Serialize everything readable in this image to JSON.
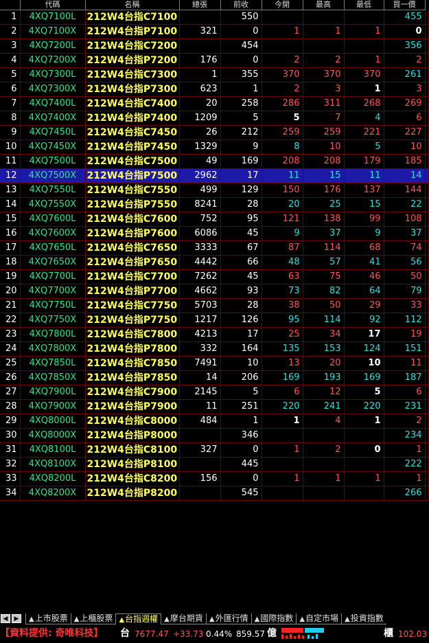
{
  "columns": [
    "代碼",
    "名稱",
    "總張",
    "前收",
    "今開",
    "最高",
    "最低",
    "買一價"
  ],
  "selected_row": 12,
  "rows": [
    {
      "no": "1",
      "code": "4XQ7100L",
      "name": "212W4台指C7100",
      "vol": "",
      "prev": "550",
      "open": "",
      "high": "",
      "low": "",
      "bid": "455"
    },
    {
      "no": "2",
      "code": "4XQ7100X",
      "name": "212W4台指P7100",
      "vol": "321",
      "prev": "0",
      "open": "1",
      "high": "1",
      "low": "1",
      "bid": "0"
    },
    {
      "no": "3",
      "code": "4XQ7200L",
      "name": "212W4台指C7200",
      "vol": "",
      "prev": "454",
      "open": "",
      "high": "",
      "low": "",
      "bid": "356"
    },
    {
      "no": "4",
      "code": "4XQ7200X",
      "name": "212W4台指P7200",
      "vol": "176",
      "prev": "0",
      "open": "2",
      "high": "2",
      "low": "1",
      "bid": "2"
    },
    {
      "no": "5",
      "code": "4XQ7300L",
      "name": "212W4台指C7300",
      "vol": "1",
      "prev": "355",
      "open": "370",
      "high": "370",
      "low": "370",
      "bid": "261"
    },
    {
      "no": "6",
      "code": "4XQ7300X",
      "name": "212W4台指P7300",
      "vol": "623",
      "prev": "1",
      "open": "2",
      "high": "3",
      "low": "1",
      "bid": "3"
    },
    {
      "no": "7",
      "code": "4XQ7400L",
      "name": "212W4台指C7400",
      "vol": "20",
      "prev": "258",
      "open": "286",
      "high": "311",
      "low": "268",
      "bid": "269"
    },
    {
      "no": "8",
      "code": "4XQ7400X",
      "name": "212W4台指P7400",
      "vol": "1209",
      "prev": "5",
      "open": "5",
      "high": "7",
      "low": "4",
      "bid": "6"
    },
    {
      "no": "9",
      "code": "4XQ7450L",
      "name": "212W4台指C7450",
      "vol": "26",
      "prev": "212",
      "open": "259",
      "high": "259",
      "low": "221",
      "bid": "227"
    },
    {
      "no": "10",
      "code": "4XQ7450X",
      "name": "212W4台指P7450",
      "vol": "1329",
      "prev": "9",
      "open": "8",
      "high": "10",
      "low": "5",
      "bid": "10"
    },
    {
      "no": "11",
      "code": "4XQ7500L",
      "name": "212W4台指C7500",
      "vol": "49",
      "prev": "169",
      "open": "208",
      "high": "208",
      "low": "179",
      "bid": "185"
    },
    {
      "no": "12",
      "code": "4XQ7500X",
      "name": "212W4台指P7500",
      "vol": "2962",
      "prev": "17",
      "open": "11",
      "high": "15",
      "low": "11",
      "bid": "14"
    },
    {
      "no": "13",
      "code": "4XQ7550L",
      "name": "212W4台指C7550",
      "vol": "499",
      "prev": "129",
      "open": "150",
      "high": "176",
      "low": "137",
      "bid": "144"
    },
    {
      "no": "14",
      "code": "4XQ7550X",
      "name": "212W4台指P7550",
      "vol": "8241",
      "prev": "28",
      "open": "20",
      "high": "25",
      "low": "15",
      "bid": "22"
    },
    {
      "no": "15",
      "code": "4XQ7600L",
      "name": "212W4台指C7600",
      "vol": "752",
      "prev": "95",
      "open": "121",
      "high": "138",
      "low": "99",
      "bid": "108"
    },
    {
      "no": "16",
      "code": "4XQ7600X",
      "name": "212W4台指P7600",
      "vol": "6086",
      "prev": "45",
      "open": "9",
      "high": "37",
      "low": "9",
      "bid": "37"
    },
    {
      "no": "17",
      "code": "4XQ7650L",
      "name": "212W4台指C7650",
      "vol": "3333",
      "prev": "67",
      "open": "87",
      "high": "114",
      "low": "68",
      "bid": "74"
    },
    {
      "no": "18",
      "code": "4XQ7650X",
      "name": "212W4台指P7650",
      "vol": "4442",
      "prev": "66",
      "open": "48",
      "high": "57",
      "low": "41",
      "bid": "56"
    },
    {
      "no": "19",
      "code": "4XQ7700L",
      "name": "212W4台指C7700",
      "vol": "7262",
      "prev": "45",
      "open": "63",
      "high": "75",
      "low": "46",
      "bid": "50"
    },
    {
      "no": "20",
      "code": "4XQ7700X",
      "name": "212W4台指P7700",
      "vol": "4662",
      "prev": "93",
      "open": "73",
      "high": "82",
      "low": "64",
      "bid": "79"
    },
    {
      "no": "21",
      "code": "4XQ7750L",
      "name": "212W4台指C7750",
      "vol": "5703",
      "prev": "28",
      "open": "38",
      "high": "50",
      "low": "29",
      "bid": "33"
    },
    {
      "no": "22",
      "code": "4XQ7750X",
      "name": "212W4台指P7750",
      "vol": "1217",
      "prev": "126",
      "open": "95",
      "high": "114",
      "low": "92",
      "bid": "112"
    },
    {
      "no": "23",
      "code": "4XQ7800L",
      "name": "212W4台指C7800",
      "vol": "4213",
      "prev": "17",
      "open": "25",
      "high": "34",
      "low": "17",
      "bid": "19"
    },
    {
      "no": "24",
      "code": "4XQ7800X",
      "name": "212W4台指P7800",
      "vol": "332",
      "prev": "164",
      "open": "135",
      "high": "153",
      "low": "124",
      "bid": "151"
    },
    {
      "no": "25",
      "code": "4XQ7850L",
      "name": "212W4台指C7850",
      "vol": "7491",
      "prev": "10",
      "open": "13",
      "high": "20",
      "low": "10",
      "bid": "11"
    },
    {
      "no": "26",
      "code": "4XQ7850X",
      "name": "212W4台指P7850",
      "vol": "14",
      "prev": "206",
      "open": "169",
      "high": "193",
      "low": "169",
      "bid": "187"
    },
    {
      "no": "27",
      "code": "4XQ7900L",
      "name": "212W4台指C7900",
      "vol": "2145",
      "prev": "5",
      "open": "6",
      "high": "12",
      "low": "5",
      "bid": "6"
    },
    {
      "no": "28",
      "code": "4XQ7900X",
      "name": "212W4台指P7900",
      "vol": "11",
      "prev": "251",
      "open": "220",
      "high": "241",
      "low": "220",
      "bid": "231"
    },
    {
      "no": "29",
      "code": "4XQ8000L",
      "name": "212W4台指C8000",
      "vol": "484",
      "prev": "1",
      "open": "1",
      "high": "4",
      "low": "1",
      "bid": "2"
    },
    {
      "no": "30",
      "code": "4XQ8000X",
      "name": "212W4台指P8000",
      "vol": "",
      "prev": "346",
      "open": "",
      "high": "",
      "low": "",
      "bid": "234"
    },
    {
      "no": "31",
      "code": "4XQ8100L",
      "name": "212W4台指C8100",
      "vol": "327",
      "prev": "0",
      "open": "1",
      "high": "2",
      "low": "0",
      "bid": "1"
    },
    {
      "no": "32",
      "code": "4XQ8100X",
      "name": "212W4台指P8100",
      "vol": "",
      "prev": "445",
      "open": "",
      "high": "",
      "low": "",
      "bid": "222"
    },
    {
      "no": "33",
      "code": "4XQ8200L",
      "name": "212W4台指C8200",
      "vol": "156",
      "prev": "0",
      "open": "1",
      "high": "1",
      "low": "1",
      "bid": "1"
    },
    {
      "no": "34",
      "code": "4XQ8200X",
      "name": "212W4台指P8200",
      "vol": "",
      "prev": "545",
      "open": "",
      "high": "",
      "low": "",
      "bid": "266"
    }
  ],
  "tabs": [
    {
      "label": "上市股票",
      "active": false
    },
    {
      "label": "上櫃股票",
      "active": false
    },
    {
      "label": "台指週權",
      "active": true
    },
    {
      "label": "摩台期貨",
      "active": false
    },
    {
      "label": "外匯行情",
      "active": false
    },
    {
      "label": "國際指數",
      "active": false
    },
    {
      "label": "自定市場",
      "active": false
    },
    {
      "label": "投資指數",
      "active": false
    }
  ],
  "nav": {
    "prev_icon": "◀",
    "next_icon": "▶"
  },
  "status": {
    "provider": "【資料提供: 奇唯科技】",
    "index_label": "台",
    "index_value": "7677.47",
    "index_change": "+33.73",
    "index_pct": "0.44%",
    "amount": "859.57",
    "amount_unit": "億",
    "otc_label": "櫃",
    "otc_value": "102.03"
  },
  "colors": {
    "up": "#ff5555",
    "down": "#33dddd",
    "neutral": "#ffffff",
    "code": "#2ee58a",
    "name": "#ffff55",
    "grid": "#6e0000",
    "selected": "#1e1aa8"
  }
}
